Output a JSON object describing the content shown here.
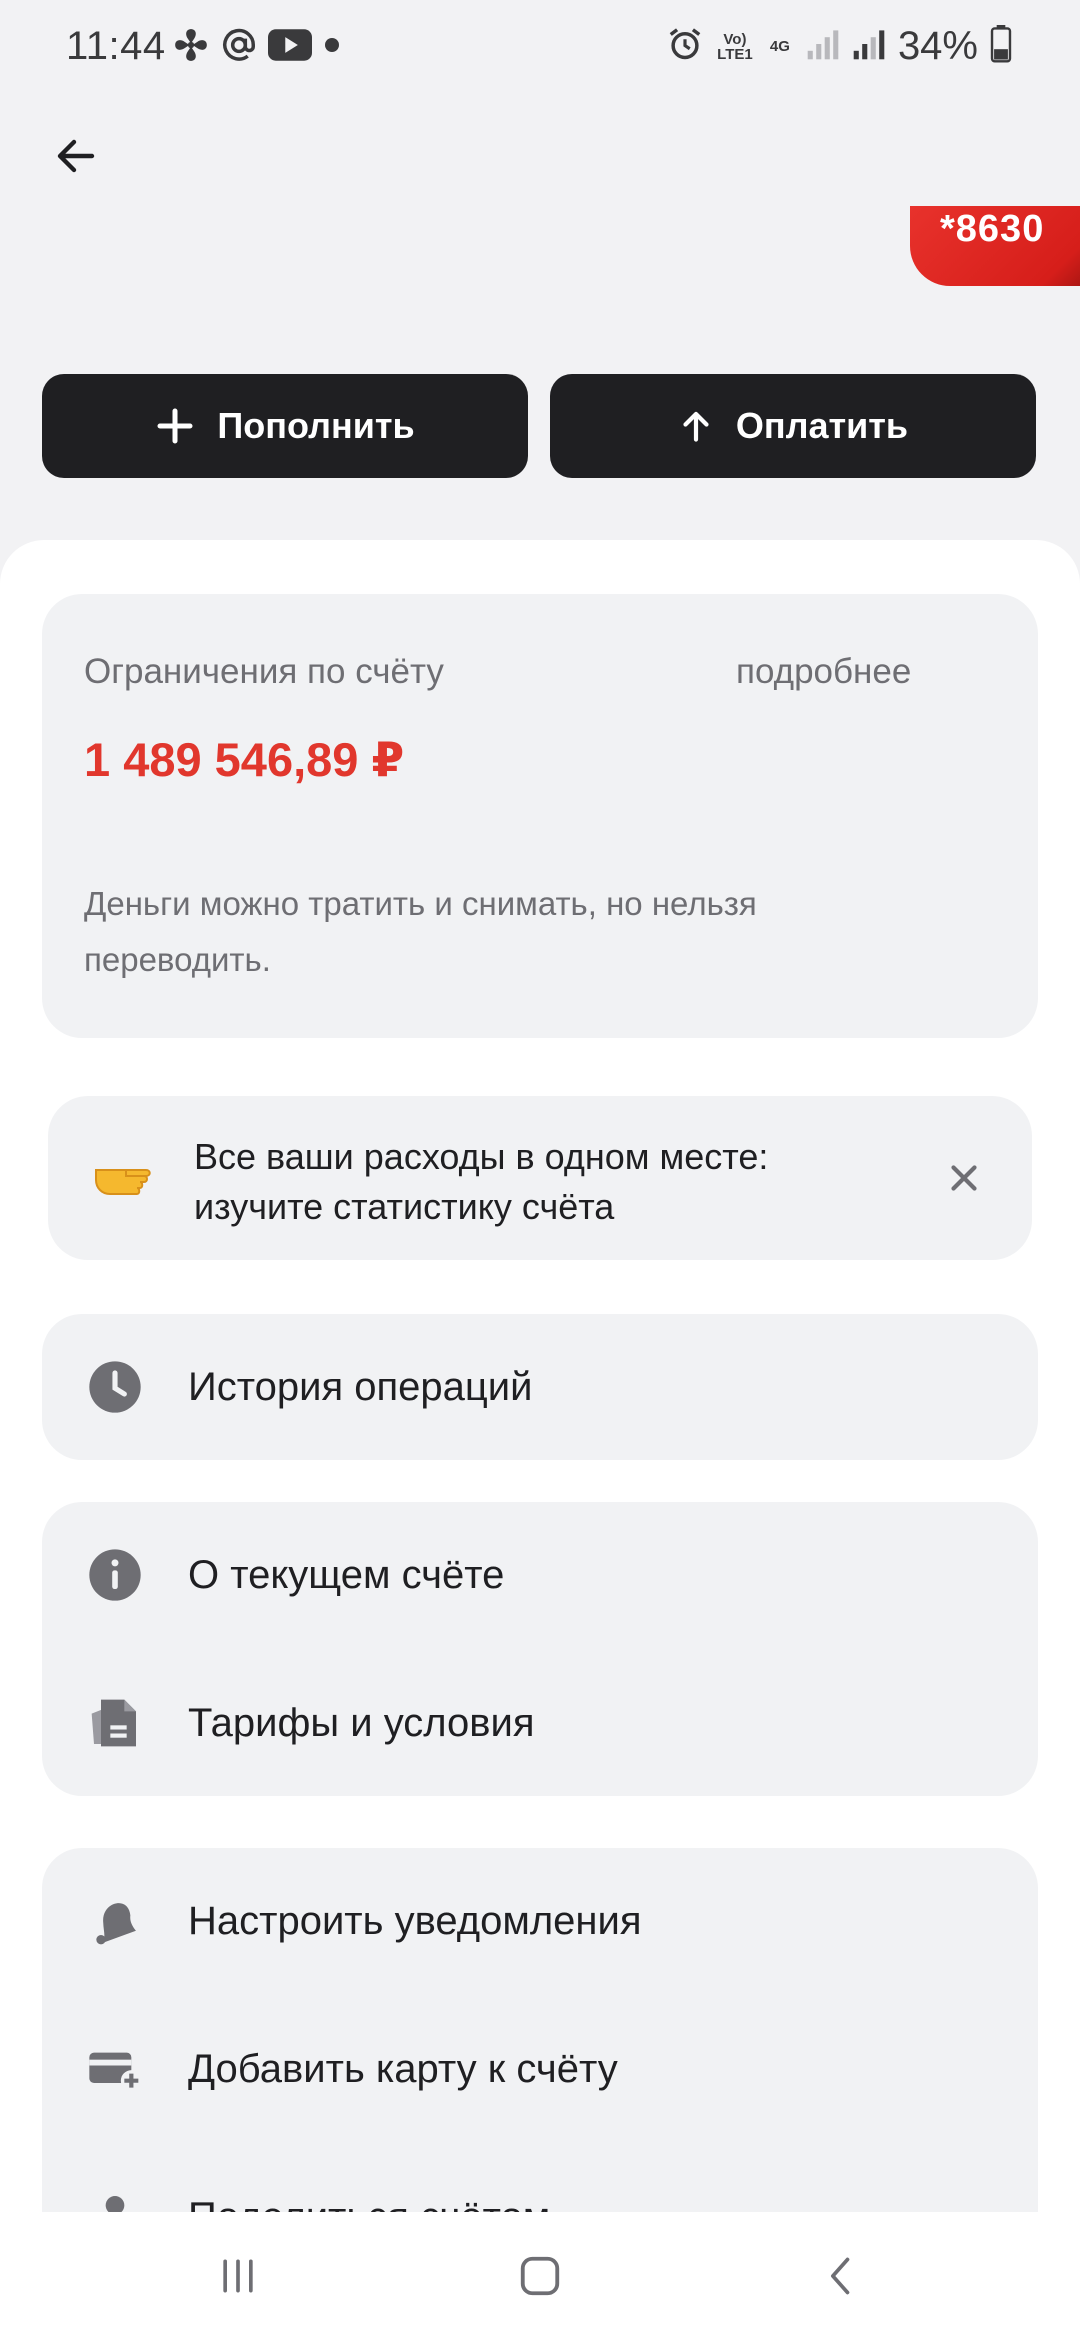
{
  "status_bar": {
    "time": "11:44",
    "battery": "34%",
    "volte_label": "Vo) LTE1",
    "network_label": "4G"
  },
  "card": {
    "number_peek": "*8630"
  },
  "actions": {
    "topup_label": "Пополнить",
    "pay_label": "Оплатить"
  },
  "limits": {
    "title": "Ограничения по счёту",
    "more": "подробнее",
    "amount": "1 489 546,89 ₽",
    "description": "Деньги можно тратить и снимать, но нельзя переводить."
  },
  "promo": {
    "text": "Все ваши расходы в одном месте: изучите статистику счёта"
  },
  "menu": {
    "history": "История операций",
    "about": "О текущем счёте",
    "tariffs": "Тарифы и условия",
    "notifications": "Настроить уведомления",
    "add_card": "Добавить карту к счёту",
    "share": "Поделиться счётом"
  },
  "colors": {
    "accent_red": "#e1372d",
    "button_dark": "#1f1f22",
    "panel_bg": "#f1f2f4",
    "icon_gray": "#6e6e73"
  }
}
